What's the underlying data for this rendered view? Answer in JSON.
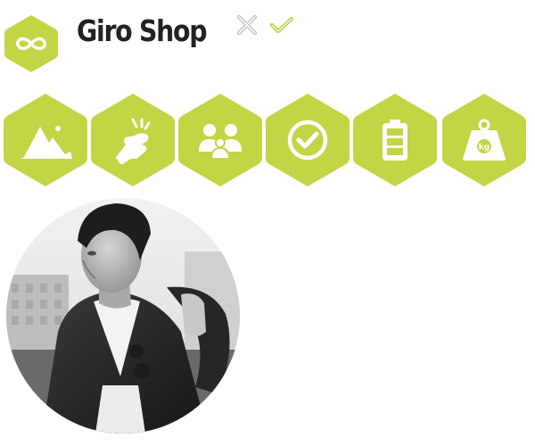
{
  "brand": {
    "name": "Giro Shop",
    "logo_icon": "infinity-icon",
    "accent_color": "#c3d545"
  },
  "status": {
    "close_icon": "close-icon",
    "check_icon": "check-icon",
    "close_color": "#c8c8c8",
    "check_color": "#b4cc3a"
  },
  "badges": [
    {
      "icon": "mountain-icon"
    },
    {
      "icon": "hand-snap-icon"
    },
    {
      "icon": "group-icon"
    },
    {
      "icon": "check-circle-icon"
    },
    {
      "icon": "battery-icon"
    },
    {
      "icon": "weight-icon",
      "label": "kg"
    }
  ],
  "avatar": {
    "icon": "user-photo-icon"
  }
}
